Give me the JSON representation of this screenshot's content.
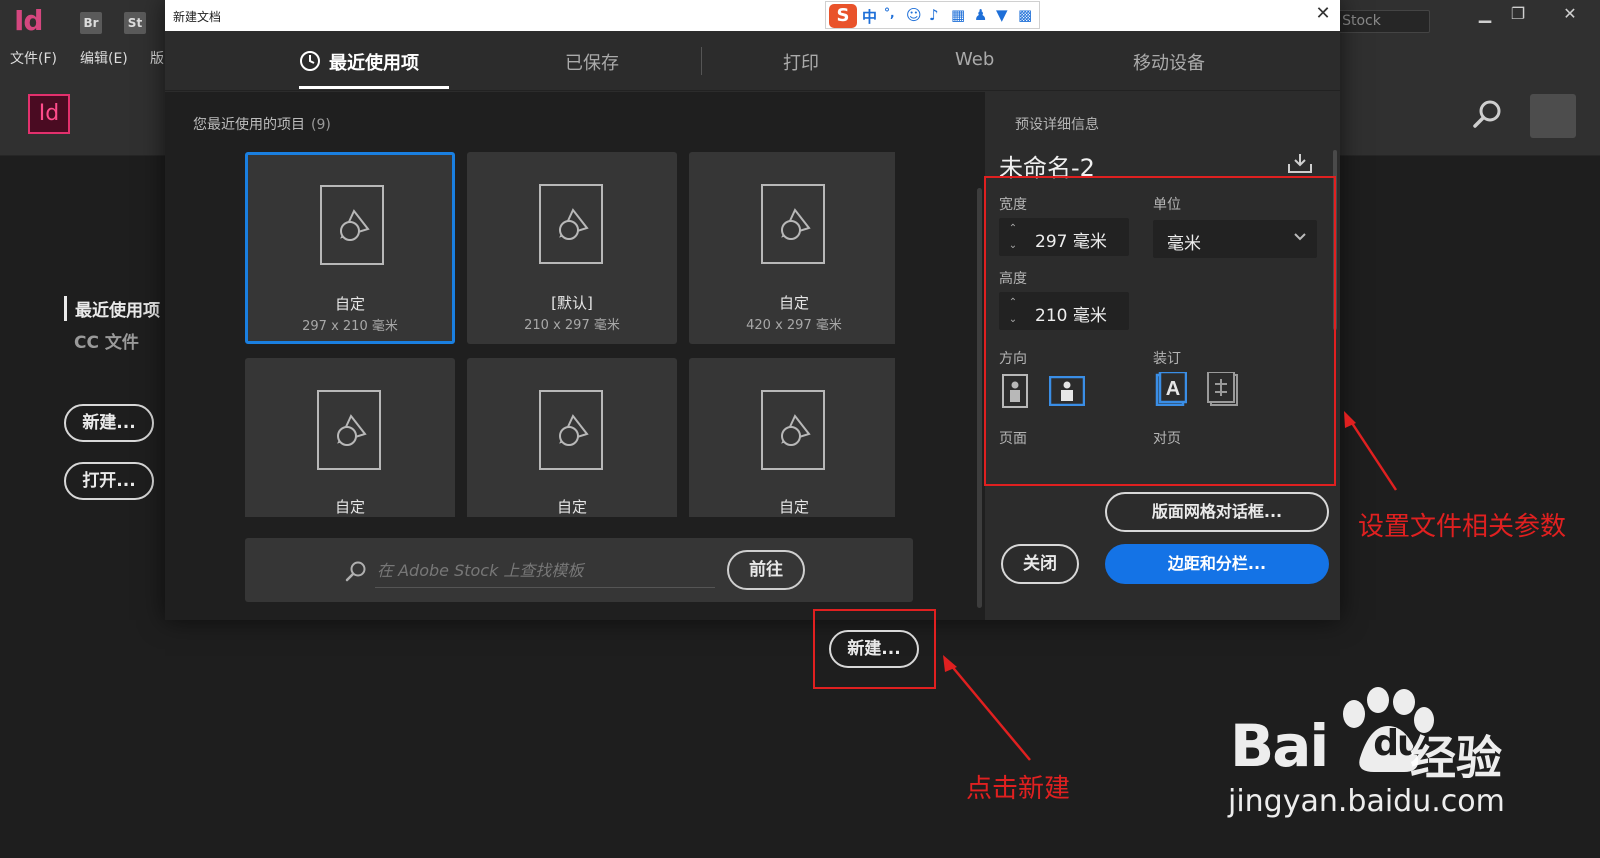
{
  "app": {
    "logo_text": "Id",
    "badges": [
      "Br",
      "St"
    ],
    "stock_search_text": "e Stock",
    "menu": [
      "文件(F)",
      "编辑(E)",
      "版"
    ],
    "brand_logo": "Id",
    "side_recent": "最近使用项",
    "side_cc": "CC 文件",
    "new_button": "新建...",
    "open_button": "打开..."
  },
  "dialog": {
    "title": "新建文档",
    "ime_logo": "S",
    "ime_glyphs": [
      "中",
      "°,",
      "☺",
      "♪",
      "▦",
      "♟",
      "▼",
      "▩"
    ],
    "tabs": [
      "最近使用项",
      "已保存",
      "打印",
      "Web",
      "移动设备"
    ],
    "recent_label": "您最近使用的项目",
    "recent_count": "(9)",
    "tiles": [
      {
        "name": "自定",
        "size": "297 x 210 毫米"
      },
      {
        "name": "[默认]",
        "size": "210 x 297 毫米"
      },
      {
        "name": "自定",
        "size": "420 x 297 毫米"
      },
      {
        "name": "自定",
        "size": ""
      },
      {
        "name": "自定",
        "size": ""
      },
      {
        "name": "自定",
        "size": ""
      }
    ],
    "stock_placeholder": "在 Adobe Stock 上查找模板",
    "goto_button": "前往",
    "preset": {
      "label": "预设详细信息",
      "doc_name": "未命名-2",
      "width_label": "宽度",
      "width_value": "297 毫米",
      "unit_label": "单位",
      "unit_value": "毫米",
      "height_label": "高度",
      "height_value": "210 毫米",
      "orientation_label": "方向",
      "binding_label": "装订",
      "pages_label": "页面",
      "facing_label": "对页"
    },
    "grid_button": "版面网格对话框...",
    "close_button": "关闭",
    "margins_button": "边距和分栏...",
    "new_button": "新建..."
  },
  "annotations": {
    "params_note": "设置文件相关参数",
    "new_note": "点击新建",
    "color": "#e02020"
  },
  "watermark": {
    "bai": "Bai",
    "du": "du",
    "jingyan": "经验",
    "url": "jingyan.baidu.com"
  },
  "colors": {
    "accent": "#1473e6",
    "selected_border": "#1a7fe0",
    "brand": "#e3306d"
  }
}
